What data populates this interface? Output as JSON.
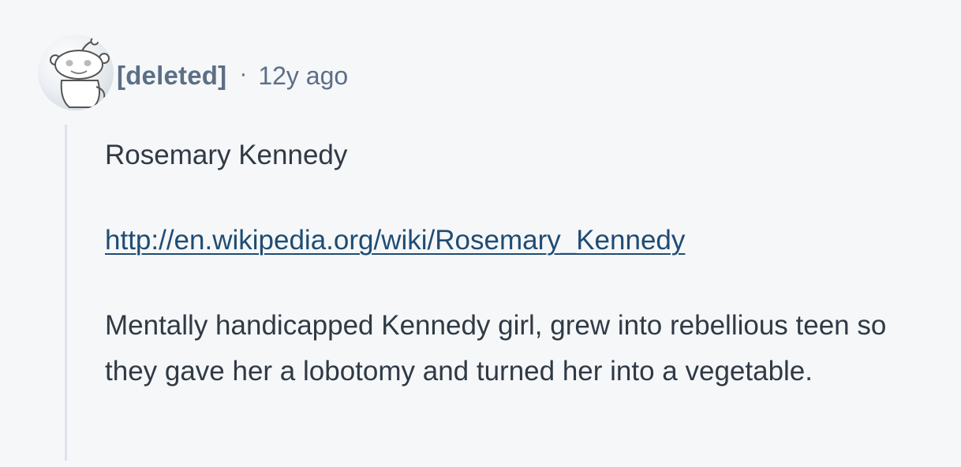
{
  "comment": {
    "author": "[deleted]",
    "separator": "·",
    "timestamp": "12y ago",
    "avatar_icon": "reddit-snoo-deleted-avatar-icon",
    "paragraphs": [
      "Rosemary Kennedy",
      "http://en.wikipedia.org/wiki/Rosemary_Kennedy",
      "Mentally handicapped Kennedy girl, grew into rebellious teen so they gave her a lobotomy and turned her into a vegetable."
    ]
  },
  "colors": {
    "background": "#f6f7f9",
    "meta_text": "#5b6f86",
    "body_text": "#2f3a45",
    "link": "#1f4c73",
    "thread_line": "#dde3ea"
  }
}
